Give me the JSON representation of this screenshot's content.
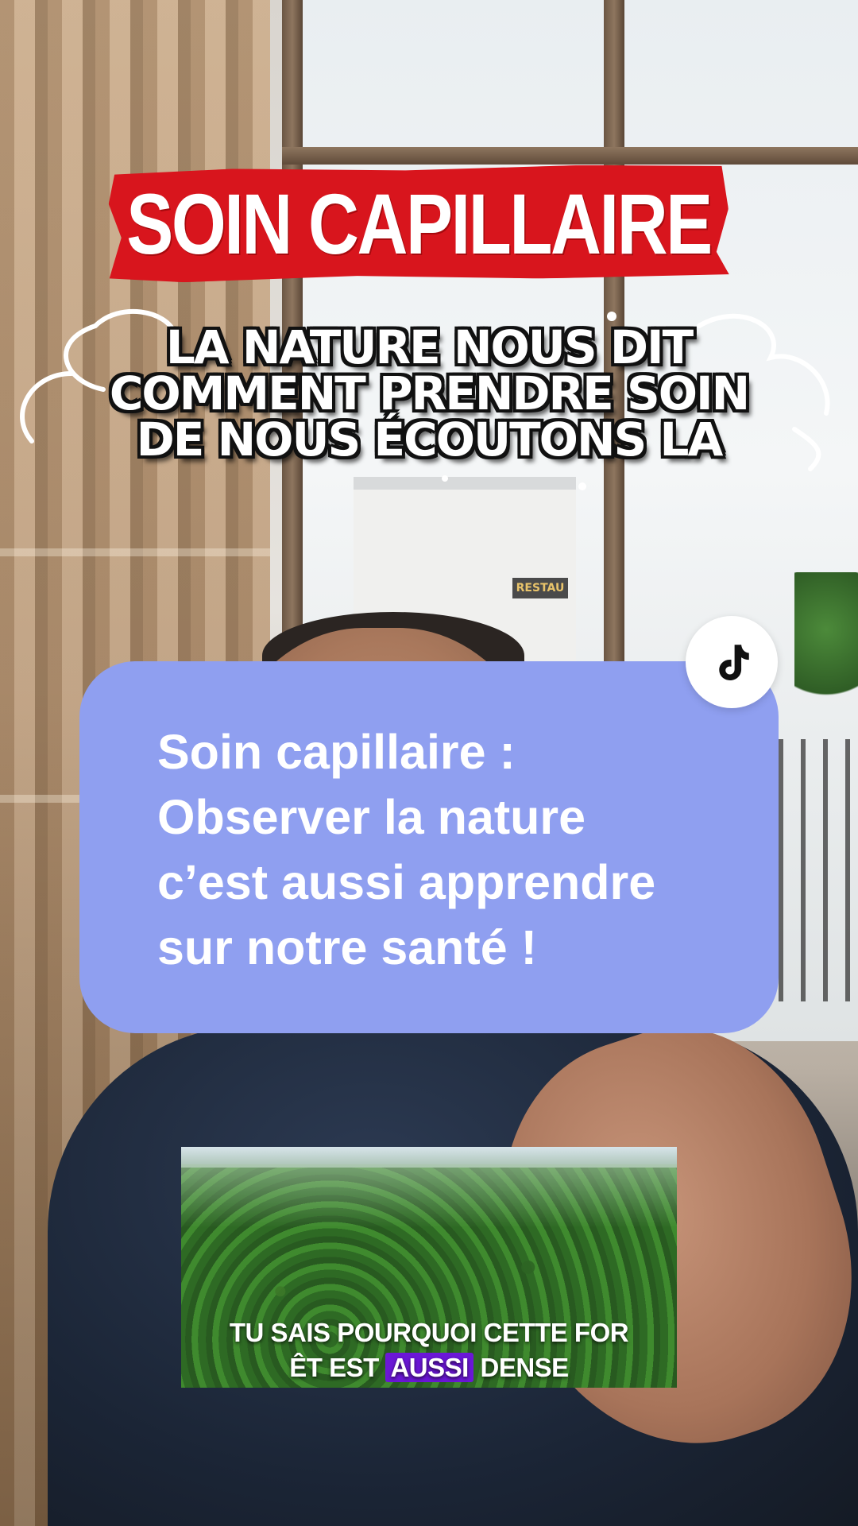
{
  "title_banner": {
    "text": "SOIN CAPILLAIRE",
    "color": "#d8151d"
  },
  "subtitle": {
    "lines": [
      "LA NATURE NOUS DIT",
      "COMMENT PRENDRE SOIN",
      "DE NOUS ÉCOUTONS LA"
    ]
  },
  "tiktok": {
    "icon": "tiktok-logo-icon"
  },
  "card": {
    "lines": [
      "Soin capillaire :",
      "Observer la nature",
      "c’est aussi apprendre",
      "sur notre santé !"
    ],
    "color": "#8f9ff0"
  },
  "background": {
    "sign_text": "RESTAU"
  },
  "inset_video": {
    "caption_line1": "TU SAIS POURQUOI CETTE FOR",
    "caption_line2_before": "ÊT EST ",
    "caption_line2_highlight": "AUSSI",
    "caption_line2_after": " DENSE",
    "highlight_color": "#6b17d6"
  }
}
